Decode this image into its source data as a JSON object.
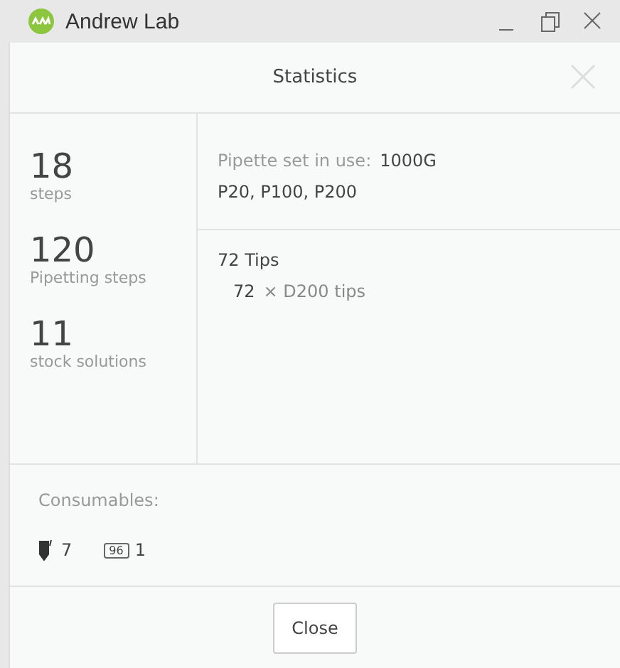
{
  "window": {
    "title": "Andrew Lab"
  },
  "dialog": {
    "title": "Statistics"
  },
  "stats": [
    {
      "value": "18",
      "label": "steps"
    },
    {
      "value": "120",
      "label": "Pipetting steps"
    },
    {
      "value": "11",
      "label": "stock solutions"
    }
  ],
  "pipettes": {
    "label": "Pipette set in use:",
    "set": "1000G",
    "models": "P20, P100, P200"
  },
  "tips": {
    "total": "72 Tips",
    "items": [
      {
        "count": "72",
        "desc": "× D200 tips"
      }
    ]
  },
  "consumables": {
    "label": "Consumables:",
    "items": [
      {
        "kind": "tube",
        "count": "7"
      },
      {
        "kind": "plate",
        "plate_label": "96",
        "count": "1"
      }
    ]
  },
  "buttons": [
    "Close"
  ]
}
